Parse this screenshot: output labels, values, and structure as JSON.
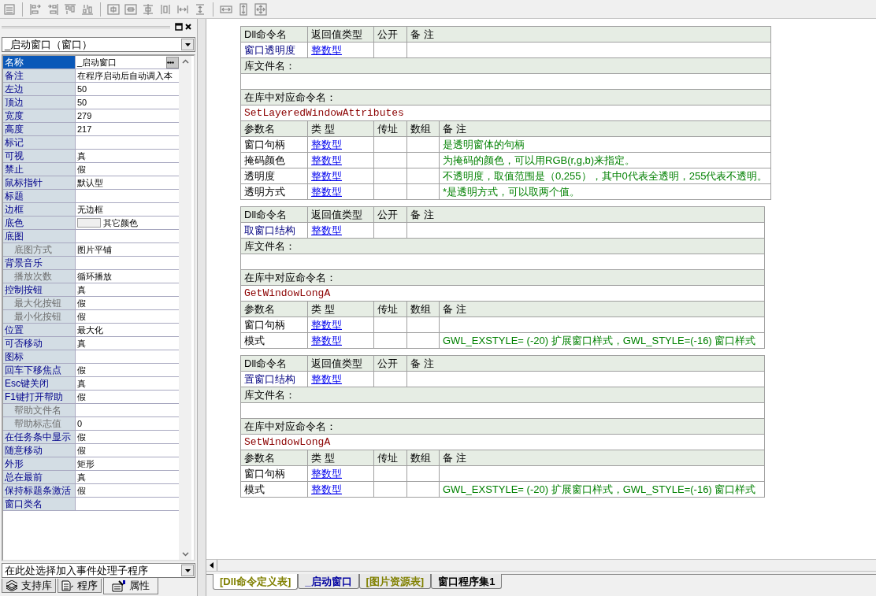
{
  "properties_panel": {
    "object_selector": "_启动窗口（窗口）",
    "properties": [
      {
        "name": "名称",
        "value": "_启动窗口",
        "selected": true
      },
      {
        "name": "备注",
        "value": "在程序启动后自动调入本",
        "selected": false
      },
      {
        "name": "左边",
        "value": "50",
        "selected": false
      },
      {
        "name": "顶边",
        "value": "50",
        "selected": false
      },
      {
        "name": "宽度",
        "value": "279",
        "selected": false
      },
      {
        "name": "高度",
        "value": "217",
        "selected": false
      },
      {
        "name": "标记",
        "selected": false
      },
      {
        "name": "可视",
        "value": "真",
        "selected": false
      },
      {
        "name": "禁止",
        "value": "假",
        "selected": false
      },
      {
        "name": "鼠标指针",
        "value": "默认型",
        "selected": false
      },
      {
        "name": "标题",
        "selected": false
      },
      {
        "name": "边框",
        "value": "无边框",
        "selected": false
      },
      {
        "name": "底色",
        "value": "其它颜色",
        "color": "#efefef",
        "selected": false
      },
      {
        "name": "底图",
        "selected": false,
        "children": [
          {
            "name": "底图方式",
            "value": "图片平铺",
            "selected": false
          }
        ]
      },
      {
        "name": "背景音乐",
        "selected": false,
        "children": [
          {
            "name": "播放次数",
            "value": "循环播放",
            "selected": false
          }
        ]
      },
      {
        "name": "控制按钮",
        "value": "真",
        "selected": false,
        "children": [
          {
            "name": "最大化按钮",
            "value": "假",
            "selected": false
          },
          {
            "name": "最小化按钮",
            "value": "假",
            "selected": false
          }
        ]
      },
      {
        "name": "位置",
        "value": "最大化",
        "selected": false
      },
      {
        "name": "可否移动",
        "value": "真",
        "selected": false
      },
      {
        "name": "图标",
        "selected": false
      },
      {
        "name": "回车下移焦点",
        "value": "假",
        "selected": false
      },
      {
        "name": "Esc键关闭",
        "value": "真",
        "selected": false
      },
      {
        "name": "F1键打开帮助",
        "value": "假",
        "selected": false,
        "children": [
          {
            "name": "帮助文件名",
            "selected": false
          },
          {
            "name": "帮助标志值",
            "value": "0",
            "selected": false
          }
        ]
      },
      {
        "name": "在任务条中显示",
        "value": "假",
        "selected": false
      },
      {
        "name": "随意移动",
        "value": "假",
        "selected": false
      },
      {
        "name": "外形",
        "value": "矩形",
        "selected": false
      },
      {
        "name": "总在最前",
        "value": "真",
        "selected": false
      },
      {
        "name": "保持标题条激活",
        "value": "假",
        "selected": false
      },
      {
        "name": "窗口类名",
        "selected": false
      }
    ],
    "event_selector": "在此处选择加入事件处理子程序",
    "tabs": [
      {
        "label": "支持库",
        "selected": false
      },
      {
        "label": "程序",
        "selected": false
      },
      {
        "label": "属性",
        "selected": true
      }
    ]
  },
  "editor": {
    "tables": [
      {
        "header": [
          "Dll命令名",
          "返回值类型",
          "公开",
          "备 注"
        ],
        "name": "窗口透明度",
        "return_type": "整数型",
        "library_label": "库文件名：",
        "command_label": "在库中对应命令名：",
        "command": "SetLayeredWindowAttributes",
        "param_header": [
          "参数名",
          "类 型",
          "传址",
          "数组",
          "备 注"
        ],
        "params": [
          {
            "name": "窗口句柄",
            "type": "整数型",
            "remark": "是透明窗体的句柄"
          },
          {
            "name": "掩码颜色",
            "type": "整数型",
            "remark": "为掩码的颜色，可以用RGB(r,g,b)来指定。"
          },
          {
            "name": "透明度",
            "type": "整数型",
            "remark": "不透明度，取值范围是（0,255），其中0代表全透明，255代表不透明。"
          },
          {
            "name": "透明方式",
            "type": "整数型",
            "remark": "*是透明方式，可以取两个值。"
          }
        ]
      },
      {
        "header": [
          "Dll命令名",
          "返回值类型",
          "公开",
          "备 注"
        ],
        "name": "取窗口结构",
        "return_type": "整数型",
        "library_label": "库文件名：",
        "command_label": "在库中对应命令名：",
        "command": "GetWindowLongA",
        "param_header": [
          "参数名",
          "类 型",
          "传址",
          "数组",
          "备 注"
        ],
        "params": [
          {
            "name": "窗口句柄",
            "type": "整数型"
          },
          {
            "name": "模式",
            "type": "整数型",
            "remark": "GWL_EXSTYLE= (-20) 扩展窗口样式，GWL_STYLE=(-16) 窗口样式"
          }
        ]
      },
      {
        "header": [
          "Dll命令名",
          "返回值类型",
          "公开",
          "备 注"
        ],
        "name": "置窗口结构",
        "return_type": "整数型",
        "library_label": "库文件名：",
        "command_label": "在库中对应命令名：",
        "command": "SetWindowLongA",
        "param_header": [
          "参数名",
          "类 型",
          "传址",
          "数组",
          "备 注"
        ],
        "params": [
          {
            "name": "窗口句柄",
            "type": "整数型"
          },
          {
            "name": "模式",
            "type": "整数型",
            "remark": "GWL_EXSTYLE= (-20) 扩展窗口样式，GWL_STYLE=(-16) 窗口样式"
          }
        ]
      }
    ],
    "tabs": [
      {
        "label": "[Dll命令定义表]",
        "selected": true,
        "color": "#808000"
      },
      {
        "label": "_启动窗口",
        "selected": false,
        "color": "#0000a0"
      },
      {
        "label": "[图片资源表]",
        "selected": false,
        "color": "#808000"
      },
      {
        "label": "窗口程序集1",
        "selected": false,
        "color": "#000000"
      }
    ]
  }
}
